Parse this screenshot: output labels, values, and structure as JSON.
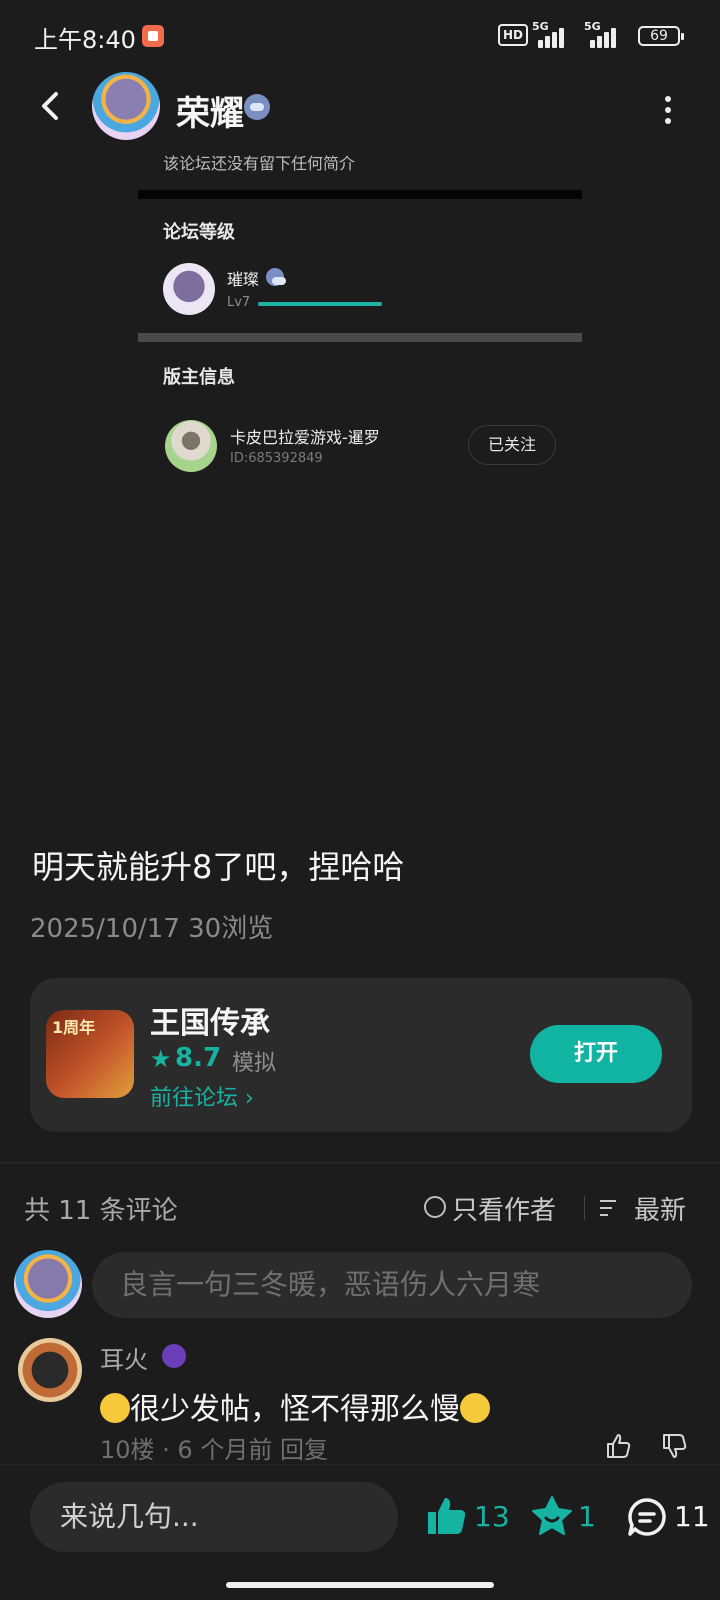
{
  "status_bar": {
    "time": "上午8:40",
    "hd": "HD",
    "net1": "5G",
    "net2": "5G",
    "battery": "69"
  },
  "header": {
    "forum_name": "荣耀",
    "icons": [
      "back-arrow-icon",
      "forum-avatar",
      "gamepad-badge-icon",
      "more-vertical-icon"
    ]
  },
  "forum_card": {
    "intro": "该论坛还没有留下任何简介",
    "level_title": "论坛等级",
    "rank_user": "璀璨",
    "rank_level": "Lv7",
    "rank_progress": 0.95,
    "moderator_title": "版主信息",
    "moderator_name": "卡皮巴拉爱游戏-暹罗",
    "moderator_id": "ID:685392849",
    "follow_label": "已关注"
  },
  "post": {
    "text": "明天就能升8了吧，捏哈哈",
    "meta": "2025/10/17  30浏览"
  },
  "game": {
    "anniversary": "1周年",
    "name": "王国传承",
    "star": "★",
    "score": "8.7",
    "genre": "模拟",
    "goto_forum": "前往论坛 ›",
    "open_label": "打开"
  },
  "comments": {
    "count_label": "共 11 条评论",
    "only_author": "只看作者",
    "sort_label": "最新",
    "input_placeholder": "良言一句三冬暖，恶语伤人六月寒",
    "items": [
      {
        "name": "耳火",
        "text": "很少发帖，怪不得那么慢",
        "meta": "10楼 · 6 个月前  回复"
      }
    ]
  },
  "bottom_bar": {
    "reply_placeholder": "来说几句...",
    "likes": "13",
    "favorites": "1",
    "comments": "11"
  },
  "colors": {
    "accent": "#11b3a3",
    "background": "#1c1c1c",
    "card": "#2b2b2b"
  }
}
